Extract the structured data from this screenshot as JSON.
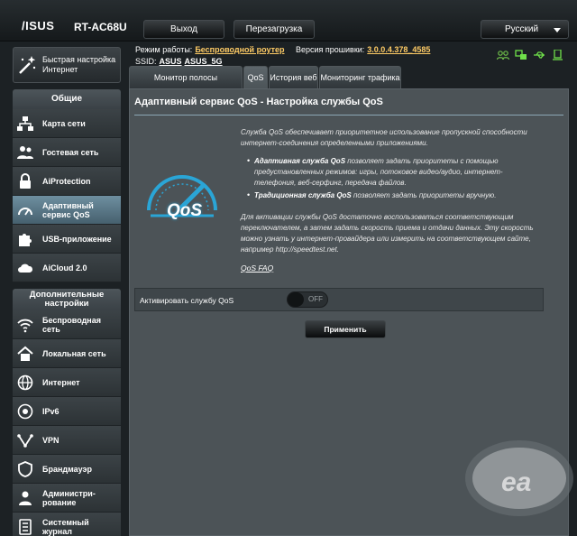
{
  "header": {
    "brand": "/ISUS",
    "model": "RT-AC68U",
    "logout_label": "Выход",
    "reboot_label": "Перезагрузка",
    "language": "Русский"
  },
  "info": {
    "mode_label": "Режим работы:",
    "mode_value": "Беспроводной роутер",
    "firmware_label": "Версия прошивки:",
    "firmware_value": "3.0.0.4.378_4585",
    "ssid_label": "SSID:",
    "ssid_1": "ASUS",
    "ssid_2": "ASUS_5G"
  },
  "sidebar": {
    "quick_setup": "Быстрая настройка Интернет",
    "general_title": "Общие",
    "general": [
      {
        "label": "Карта сети",
        "icon": "network-map-icon"
      },
      {
        "label": "Гостевая сеть",
        "icon": "guest-network-icon"
      },
      {
        "label": "AiProtection",
        "icon": "lock-icon"
      },
      {
        "label": "Адаптивный сервис QoS",
        "icon": "speedometer-icon"
      },
      {
        "label": "USB-приложение",
        "icon": "puzzle-icon"
      },
      {
        "label": "AiCloud 2.0",
        "icon": "cloud-icon"
      }
    ],
    "advanced_title": "Дополнительные настройки",
    "advanced": [
      {
        "label": "Беспроводная сеть",
        "icon": "wireless-icon"
      },
      {
        "label": "Локальная сеть",
        "icon": "home-icon"
      },
      {
        "label": "Интернет",
        "icon": "globe-icon"
      },
      {
        "label": "IPv6",
        "icon": "ipv6-icon"
      },
      {
        "label": "VPN",
        "icon": "vpn-icon"
      },
      {
        "label": "Брандмауэр",
        "icon": "firewall-icon"
      },
      {
        "label": "Администри-рование",
        "icon": "admin-icon"
      },
      {
        "label": "Системный журнал",
        "icon": "log-icon"
      }
    ]
  },
  "tabs": [
    "Монитор полосы пропускания",
    "QoS",
    "История веб",
    "Мониторинг трафика"
  ],
  "main": {
    "title": "Адаптивный сервис QoS - Настройка службы QoS",
    "intro": "Служба QoS обеспечивает приоритетное использование пропускной способности интернет-соединения определенными приложениями.",
    "bullet1_bold": "Адаптивная служба QoS",
    "bullet1_rest": " позволяет задать приоритеты с помощью предустановленных режимов: игры, потоковое видео/аудио, интернет-телефония, веб-серфинг, передача файлов.",
    "bullet2_bold": "Традиционная служба QoS",
    "bullet2_rest": " позволяет задать приоритеты вручную.",
    "para2": "Для активации службы QoS достаточно воспользоваться соответствующим переключателем, а затем задать скорость приема и отдачи данных. Эту скорость можно узнать у интернет-провайдера или измерить на соответствующем сайте, например http://speedtest.net.",
    "faq": "QoS FAQ",
    "enable_label": "Активировать службу QoS",
    "toggle_state": "OFF",
    "apply_label": "Применить",
    "logo_text": "QoS"
  },
  "colors": {
    "accent": "#ffcc66",
    "active_nav": "#5a7c8e",
    "qos_logo": "#2aa5d6"
  }
}
